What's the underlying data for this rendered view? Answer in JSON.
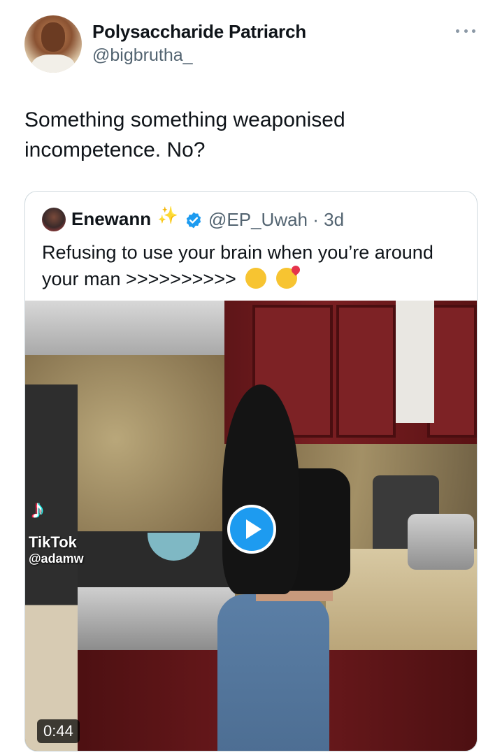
{
  "author": {
    "display_name": "Polysaccharide Patriarch",
    "handle": "@bigbrutha_"
  },
  "tweet": {
    "text": "Something something weaponised incompetence. No?"
  },
  "quoted_tweet": {
    "display_name": "Enewann",
    "name_emoji": "sparkles",
    "verified": true,
    "handle_time": "@EP_Uwah · 3d",
    "text": "Refusing to use your brain when you’re around your man >>>>>>>>>>",
    "text_emojis": [
      "face-with-hand-over-mouth",
      "smiling-face-with-hearts"
    ],
    "video": {
      "duration": "0:44",
      "watermark_brand": "TikTok",
      "watermark_user": "@adamw"
    }
  },
  "colors": {
    "accent": "#1d9bf0",
    "secondary_text": "#536471",
    "border": "#cfd9de"
  }
}
